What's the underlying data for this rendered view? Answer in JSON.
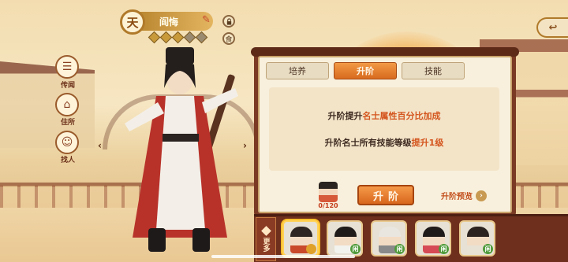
{
  "header": {
    "rank": "天",
    "hero_name": "阎悔",
    "lock_icon": "lock-icon",
    "food_label": "食"
  },
  "side_nav": [
    {
      "label": "传闻",
      "icon": "scroll-icon"
    },
    {
      "label": "住所",
      "icon": "house-icon"
    },
    {
      "label": "找人",
      "icon": "person-search-icon"
    }
  ],
  "tabs": [
    {
      "label": "培养",
      "active": false
    },
    {
      "label": "升阶",
      "active": true
    },
    {
      "label": "技能",
      "active": false
    }
  ],
  "upgrade": {
    "line1_prefix": "升阶提升",
    "line1_highlight": "名士属性百分比加成",
    "line2_prefix": "升阶名士所有技能等级",
    "line2_highlight": "提升1级",
    "cost_count": "0/120",
    "button_label": "升阶",
    "preview_label": "升阶预览"
  },
  "bottom": {
    "more_label": "更多",
    "slots": [
      {
        "tag": "",
        "tag_color": "#e0a12a",
        "hair": "#2d2622",
        "robe": "#c94a2a",
        "selected": true
      },
      {
        "tag": "闲",
        "tag_color": "#4f9a3a",
        "hair": "#1f1b1a",
        "robe": "#f2f2ee",
        "selected": false
      },
      {
        "tag": "闲",
        "tag_color": "#4f9a3a",
        "hair": "#e9e6e0",
        "robe": "#8a8a8a",
        "selected": false
      },
      {
        "tag": "闲",
        "tag_color": "#4f9a3a",
        "hair": "#1f1b1a",
        "robe": "#d64a55",
        "selected": false
      },
      {
        "tag": "闲",
        "tag_color": "#4f9a3a",
        "hair": "#2a2320",
        "robe": "#e8e2d4",
        "selected": false
      }
    ]
  },
  "colors": {
    "accent": "#d86a1e",
    "highlight_text": "#d4551e",
    "panel_frame": "#7a3a24"
  }
}
